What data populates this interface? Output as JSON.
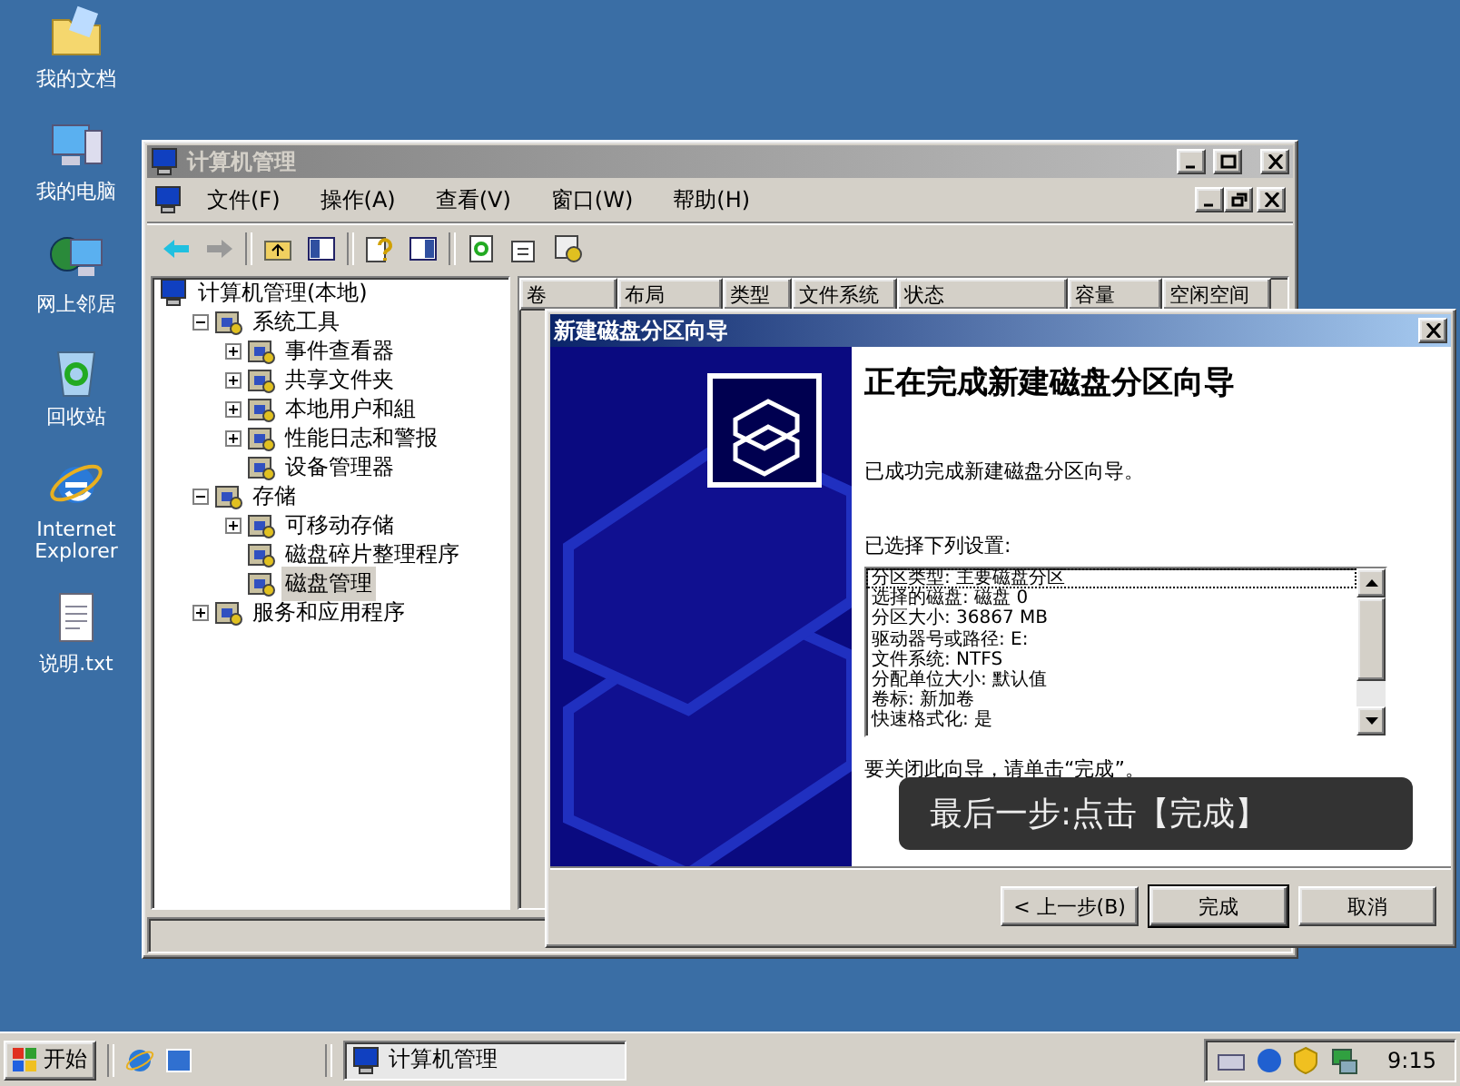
{
  "desktop_icons": [
    {
      "label": "我的文档",
      "kind": "folder"
    },
    {
      "label": "我的电脑",
      "kind": "computer"
    },
    {
      "label": "网上邻居",
      "kind": "network"
    },
    {
      "label": "回收站",
      "kind": "bin"
    },
    {
      "label": "Internet Explorer",
      "kind": "browser"
    },
    {
      "label": "说明.txt",
      "kind": "text"
    }
  ],
  "main_window": {
    "title": "计算机管理",
    "menu": [
      "文件(F)",
      "操作(A)",
      "查看(V)",
      "窗口(W)",
      "帮助(H)"
    ],
    "tree": [
      {
        "label": "计算机管理(本地)",
        "kind": "root",
        "selected": false,
        "children": [
          {
            "label": "系统工具",
            "kind": "collapse",
            "selected": false,
            "children": [
              {
                "label": "事件查看器",
                "kind": "expand",
                "selected": false
              },
              {
                "label": "共享文件夹",
                "kind": "expand",
                "selected": false
              },
              {
                "label": "本地用户和組",
                "kind": "expand",
                "selected": false
              },
              {
                "label": "性能日志和警报",
                "kind": "expand",
                "selected": false
              },
              {
                "label": "设备管理器",
                "kind": "leaf",
                "selected": false
              }
            ]
          },
          {
            "label": "存储",
            "kind": "collapse",
            "selected": false,
            "children": [
              {
                "label": "可移动存储",
                "kind": "expand",
                "selected": false
              },
              {
                "label": "磁盘碎片整理程序",
                "kind": "leaf",
                "selected": false
              },
              {
                "label": "磁盘管理",
                "kind": "leaf",
                "selected": true
              }
            ]
          },
          {
            "label": "服务和应用程序",
            "kind": "expand",
            "selected": false
          }
        ]
      }
    ],
    "columns": [
      "卷",
      "布局",
      "类型",
      "文件系统",
      "状态",
      "容量",
      "空闲空间"
    ]
  },
  "wizard": {
    "title": "新建磁盘分区向导",
    "heading": "正在完成新建磁盘分区向导",
    "intro": "已成功完成新建磁盘分区向导。",
    "settings_label": "已选择下列设置:",
    "settings": [
      {
        "text": "分区类型: 主要磁盘分区",
        "selected": true
      },
      {
        "text": "选择的磁盘: 磁盘 0",
        "selected": false
      },
      {
        "text": "分区大小: 36867 MB",
        "selected": false
      },
      {
        "text": "驱动器号或路径: E:",
        "selected": false
      },
      {
        "text": "文件系统: NTFS",
        "selected": false
      },
      {
        "text": "分配单位大小: 默认值",
        "selected": false
      },
      {
        "text": "卷标: 新加卷",
        "selected": false
      },
      {
        "text": "快速格式化: 是",
        "selected": false
      }
    ],
    "closing": "要关闭此向导，请单击“完成”。",
    "buttons": [
      {
        "label": "< 上一步(B)",
        "kind": "normal"
      },
      {
        "label": "完成",
        "kind": "default"
      },
      {
        "label": "取消",
        "kind": "normal"
      }
    ]
  },
  "caption": "最后一步:点击【完成】",
  "taskbar": {
    "start": "开始",
    "tasks": [
      {
        "label": "计算机管理",
        "selected": true
      }
    ],
    "clock": "9:15"
  }
}
